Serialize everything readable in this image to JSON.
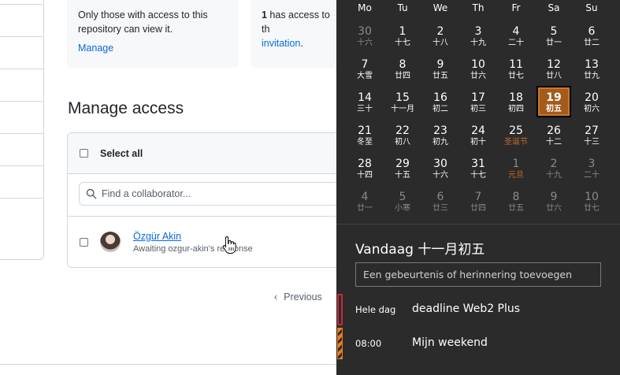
{
  "repo": {
    "private_card_text": "Only those with access to this repository can view it.",
    "private_card_link": "Manage",
    "access_card_count": "1",
    "access_card_text": " has access to th",
    "access_card_link": "invitation",
    "access_card_suffix": "."
  },
  "manage_access": {
    "title": "Manage access",
    "select_all_label": "Select all",
    "search_placeholder": "Find a collaborator...",
    "collaborators": [
      {
        "name": "Özgür Akin",
        "status": "Awaiting ozgur-akin's response"
      }
    ]
  },
  "pagination": {
    "previous_label": "Previous"
  },
  "calendar": {
    "weekdays": [
      "Mo",
      "Tu",
      "We",
      "Th",
      "Fr",
      "Sa",
      "Su"
    ],
    "weeks": [
      [
        {
          "d": "30",
          "l": "十六",
          "muted": true
        },
        {
          "d": "1",
          "l": "十七"
        },
        {
          "d": "2",
          "l": "十八"
        },
        {
          "d": "3",
          "l": "十九"
        },
        {
          "d": "4",
          "l": "二十"
        },
        {
          "d": "5",
          "l": "廿一"
        },
        {
          "d": "6",
          "l": "廿二"
        }
      ],
      [
        {
          "d": "7",
          "l": "大雪"
        },
        {
          "d": "8",
          "l": "廿四"
        },
        {
          "d": "9",
          "l": "廿五"
        },
        {
          "d": "10",
          "l": "廿六"
        },
        {
          "d": "11",
          "l": "廿七"
        },
        {
          "d": "12",
          "l": "廿八"
        },
        {
          "d": "13",
          "l": "廿九"
        }
      ],
      [
        {
          "d": "14",
          "l": "三十"
        },
        {
          "d": "15",
          "l": "十一月"
        },
        {
          "d": "16",
          "l": "初二"
        },
        {
          "d": "17",
          "l": "初三"
        },
        {
          "d": "18",
          "l": "初四"
        },
        {
          "d": "19",
          "l": "初五",
          "today": true
        },
        {
          "d": "20",
          "l": "初六"
        }
      ],
      [
        {
          "d": "21",
          "l": "冬至"
        },
        {
          "d": "22",
          "l": "初八"
        },
        {
          "d": "23",
          "l": "初九"
        },
        {
          "d": "24",
          "l": "初十"
        },
        {
          "d": "25",
          "l": "圣诞节",
          "holiday": true
        },
        {
          "d": "26",
          "l": "十二"
        },
        {
          "d": "27",
          "l": "十三"
        }
      ],
      [
        {
          "d": "28",
          "l": "十四"
        },
        {
          "d": "29",
          "l": "十五"
        },
        {
          "d": "30",
          "l": "十六"
        },
        {
          "d": "31",
          "l": "十七"
        },
        {
          "d": "1",
          "l": "元旦",
          "muted": true,
          "holiday": true
        },
        {
          "d": "2",
          "l": "十九",
          "muted": true
        },
        {
          "d": "3",
          "l": "二十",
          "muted": true
        }
      ],
      [
        {
          "d": "4",
          "l": "廿一",
          "muted": true
        },
        {
          "d": "5",
          "l": "小寒",
          "muted": true
        },
        {
          "d": "6",
          "l": "廿三",
          "muted": true
        },
        {
          "d": "7",
          "l": "廿四",
          "muted": true
        },
        {
          "d": "8",
          "l": "廿五",
          "muted": true
        },
        {
          "d": "9",
          "l": "廿六",
          "muted": true
        },
        {
          "d": "10",
          "l": "廿七",
          "muted": true
        }
      ]
    ],
    "today_label": "Vandaag 十一月初五",
    "event_placeholder": "Een gebeurtenis of herinnering toevoegen",
    "events": [
      {
        "time": "Hele dag",
        "title": "deadline Web2 Plus",
        "color": "#c6283a"
      },
      {
        "time": "08:00",
        "title": "Mijn weekend",
        "color": "#e87d1e"
      }
    ]
  },
  "colors": {
    "link": "#0969da",
    "today_accent": "#a35b1c",
    "flyout_bg": "#2b2b2b"
  }
}
